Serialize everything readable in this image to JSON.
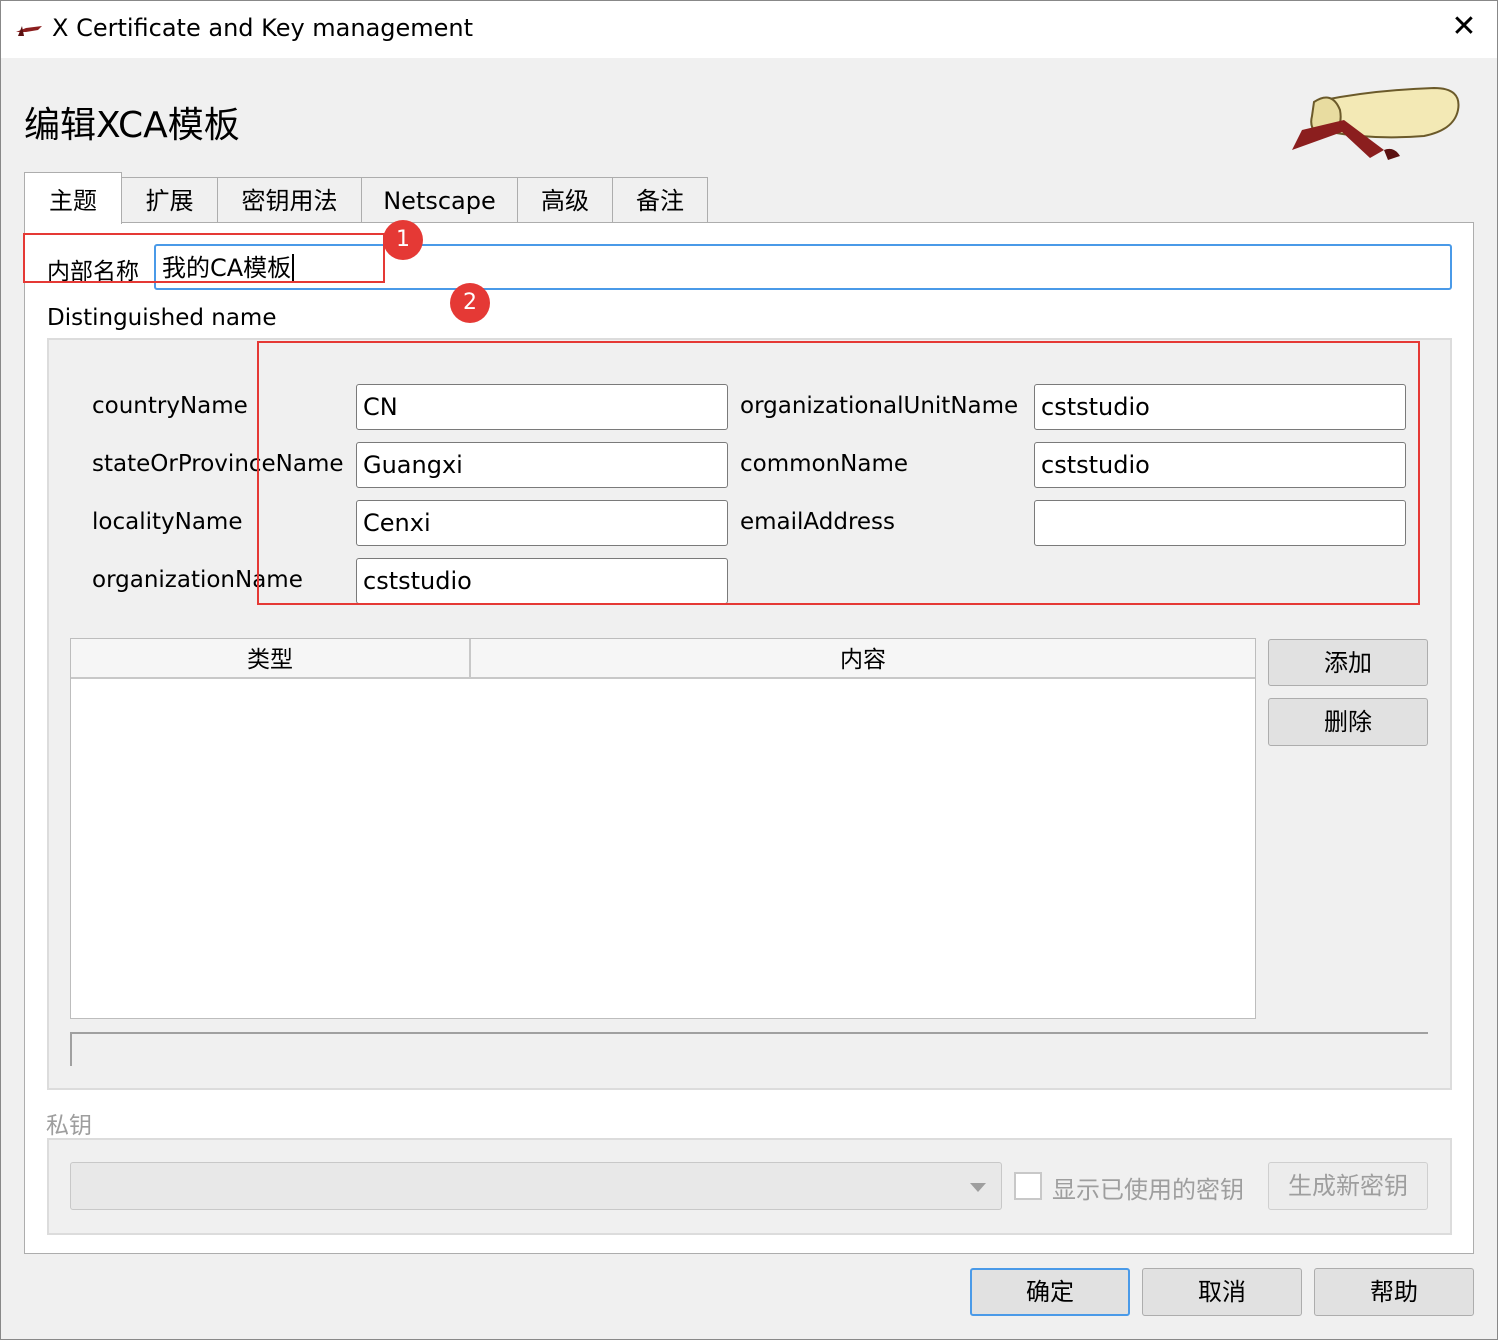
{
  "window": {
    "title": "X Certificate and Key management",
    "close_glyph": "✕"
  },
  "dialog": {
    "heading": "编辑XCA模板"
  },
  "tabs": [
    {
      "label": "主题"
    },
    {
      "label": "扩展"
    },
    {
      "label": "密钥用法"
    },
    {
      "label": "Netscape"
    },
    {
      "label": "高级"
    },
    {
      "label": "备注"
    }
  ],
  "internal_name": {
    "label": "内部名称",
    "value": "我的CA模板"
  },
  "dn": {
    "title": "Distinguished name",
    "fields": {
      "countryName": {
        "label": "countryName",
        "value": "CN"
      },
      "stateOrProvinceName": {
        "label": "stateOrProvinceName",
        "value": "Guangxi"
      },
      "localityName": {
        "label": "localityName",
        "value": "Cenxi"
      },
      "organizationName": {
        "label": "organizationName",
        "value": "cststudio"
      },
      "organizationalUnitName": {
        "label": "organizationalUnitName",
        "value": "cststudio"
      },
      "commonName": {
        "label": "commonName",
        "value": "cststudio"
      },
      "emailAddress": {
        "label": "emailAddress",
        "value": ""
      }
    },
    "table": {
      "columns": [
        "类型",
        "内容"
      ]
    },
    "add_label": "添加",
    "delete_label": "删除"
  },
  "private_key": {
    "title": "私钥",
    "show_used_label": "显示已使用的密钥",
    "generate_label": "生成新密钥"
  },
  "footer": {
    "ok_label": "确定",
    "cancel_label": "取消",
    "help_label": "帮助"
  },
  "annotations": {
    "badge1": "1",
    "badge2": "2"
  },
  "colors": {
    "annotation_red": "#e53935",
    "focus_blue": "#4a9ae8"
  }
}
